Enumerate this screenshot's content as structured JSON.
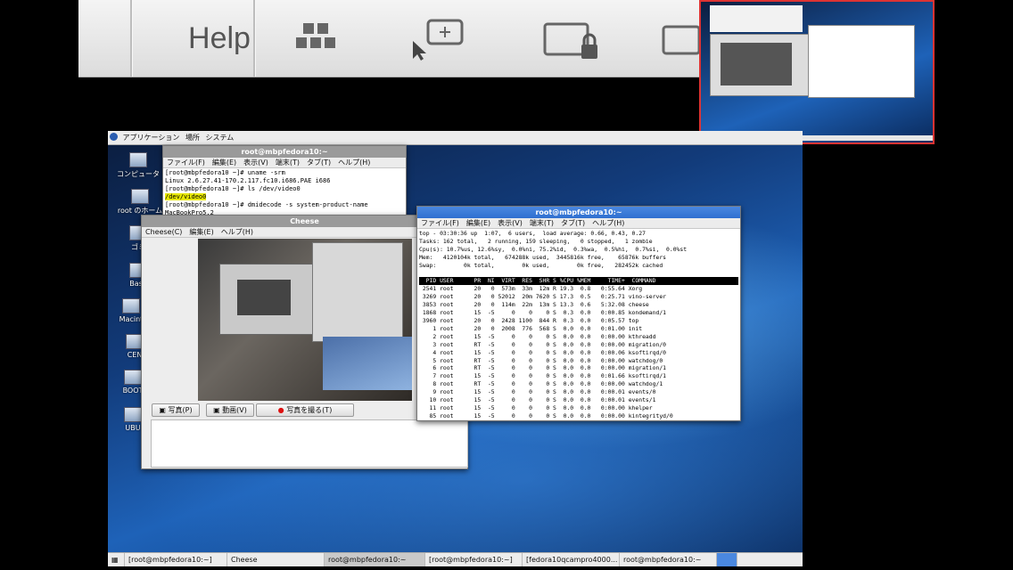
{
  "toolbar": {
    "help_label": "Help",
    "icons": [
      "apps-grid-icon",
      "select-region-icon",
      "lock-screen-icon",
      "window-icon"
    ]
  },
  "desktop": {
    "top_panel": {
      "items": [
        "アプリケーション",
        "場所",
        "システム"
      ]
    },
    "icons": [
      {
        "label": "コンピュータ"
      },
      {
        "label": "root のホーム"
      },
      {
        "label": "ゴミ"
      },
      {
        "label": "Base"
      },
      {
        "label": "Macint"
      },
      {
        "label": "CEN"
      },
      {
        "label": "BOOT"
      },
      {
        "label": "UBU"
      }
    ],
    "taskbar": [
      "[root@mbpfedora10:~]",
      "Cheese",
      "root@mbpfedora10:~",
      "[root@mbpfedora10:~]",
      "[fedora10qcampro4000...",
      "root@mbpfedora10:~"
    ]
  },
  "term1": {
    "title": "root@mbpfedora10:~",
    "menu": [
      "ファイル(F)",
      "編集(E)",
      "表示(V)",
      "端末(T)",
      "タブ(T)",
      "ヘルプ(H)"
    ],
    "lines": [
      "[root@mbpfedora10 ~]# uname -srm",
      "Linux 2.6.27.41-170.2.117.fc10.i686.PAE i686",
      "[root@mbpfedora10 ~]# ls /dev/video0",
      "/dev/video0",
      "[root@mbpfedora10 ~]# dmidecode -s system-product-name",
      "MacBookPro5,2"
    ]
  },
  "cheese": {
    "title": "Cheese",
    "menu": [
      "Cheese(C)",
      "編集(E)",
      "ヘルプ(H)"
    ],
    "photo_label": "写真(P)",
    "video_label": "動画(V)",
    "capture_label": "写真を撮る(T)"
  },
  "top": {
    "title": "root@mbpfedora10:~",
    "menu": [
      "ファイル(F)",
      "編集(E)",
      "表示(V)",
      "端末(T)",
      "タブ(T)",
      "ヘルプ(H)"
    ],
    "summary": [
      "top - 03:30:36 up  1:07,  6 users,  load average: 0.66, 0.43, 0.27",
      "Tasks: 162 total,   2 running, 159 sleeping,   0 stopped,   1 zombie",
      "Cpu(s): 10.7%us, 12.6%sy,  0.0%ni, 75.2%id,  0.3%wa,  0.5%hi,  0.7%si,  0.0%st",
      "Mem:   4120104k total,   674288k used,  3445816k free,    65876k buffers",
      "Swap:        0k total,        0k used,        0k free,   282452k cached"
    ],
    "header": "  PID USER      PR  NI  VIRT  RES  SHR S %CPU %MEM     TIME+  COMMAND     ",
    "rows": [
      " 2541 root      20   0  573m  33m  12m R 19.3  0.8   0:55.64 Xorg",
      " 3269 root      20   0 52012  20m 7620 S 17.3  0.5   0:25.71 vino-server",
      " 3853 root      20   0  114m  22m  13m S 13.3  0.6   5:32.08 cheese",
      " 1868 root      15  -5     0    0    0 S  0.3  0.0   0:00.85 kondemand/1",
      " 3960 root      20   0  2428 1100  844 R  0.3  0.0   0:05.57 top",
      "    1 root      20   0  2008  776  568 S  0.0  0.0   0:01.00 init",
      "    2 root      15  -5     0    0    0 S  0.0  0.0   0:00.00 kthreadd",
      "    3 root      RT  -5     0    0    0 S  0.0  0.0   0:00.00 migration/0",
      "    4 root      15  -5     0    0    0 S  0.0  0.0   0:00.06 ksoftirqd/0",
      "    5 root      RT  -5     0    0    0 S  0.0  0.0   0:00.00 watchdog/0",
      "    6 root      RT  -5     0    0    0 S  0.0  0.0   0:00.00 migration/1",
      "    7 root      15  -5     0    0    0 S  0.0  0.0   0:01.66 ksoftirqd/1",
      "    8 root      RT  -5     0    0    0 S  0.0  0.0   0:00.00 watchdog/1",
      "    9 root      15  -5     0    0    0 S  0.0  0.0   0:00.01 events/0",
      "   10 root      15  -5     0    0    0 S  0.0  0.0   0:00.01 events/1",
      "   11 root      15  -5     0    0    0 S  0.0  0.0   0:00.00 khelper",
      "   85 root      15  -5     0    0    0 S  0.0  0.0   0:00.00 kintegrityd/0"
    ]
  },
  "colors": {
    "title_active": "#2f6fd0",
    "title_inactive": "#9a9a9a",
    "thumb_border": "#dd3333"
  }
}
